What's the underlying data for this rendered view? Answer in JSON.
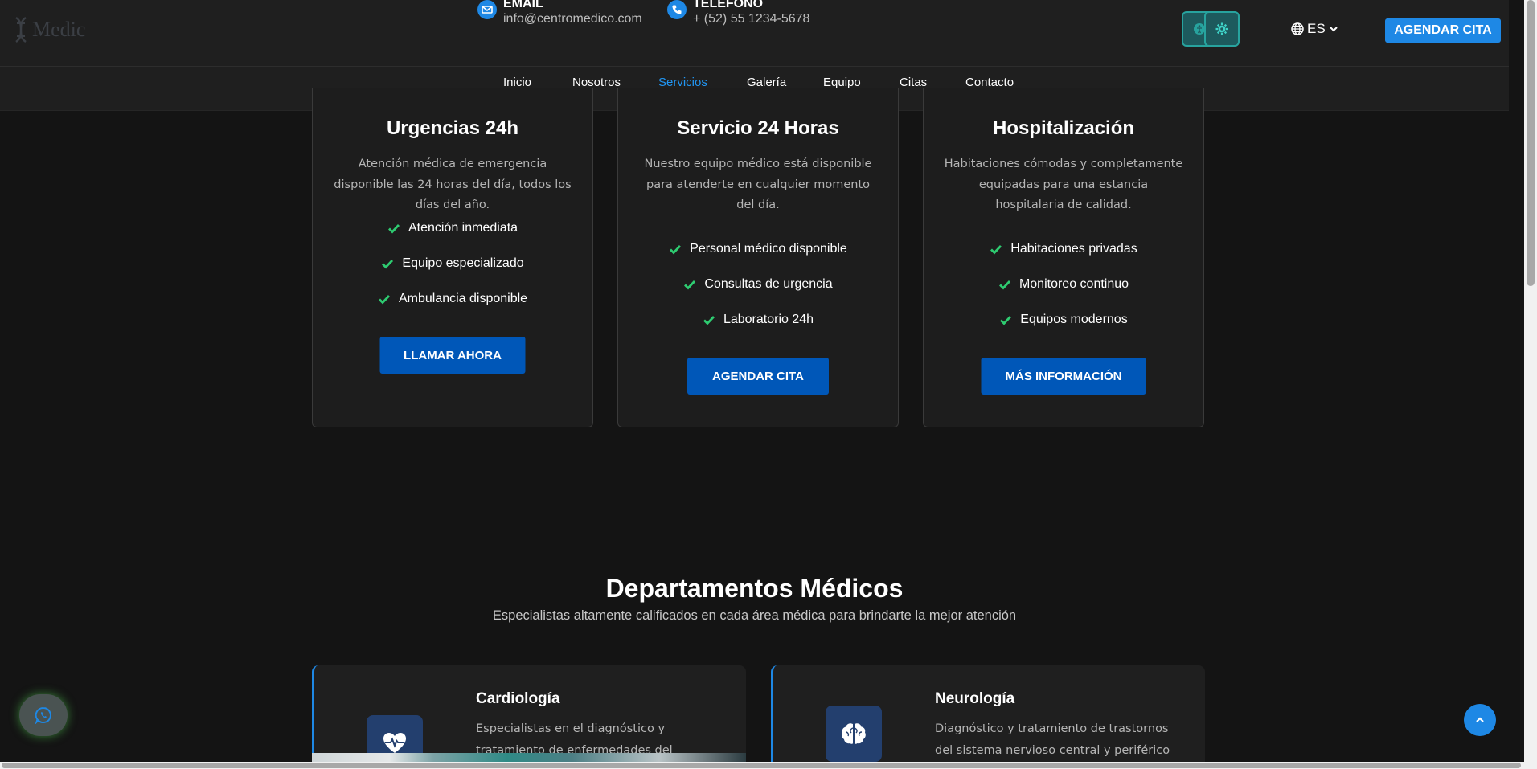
{
  "header": {
    "logo_text": "Medic",
    "contacts": [
      {
        "label": "EMAIL",
        "value": "info@centromedico.com",
        "icon": "mail-icon"
      },
      {
        "label": "TELEFONO",
        "value": "+ (52) 55 1234-5678",
        "icon": "phone-icon"
      }
    ],
    "language": "ES",
    "cta_label": "AGENDAR CITA"
  },
  "nav": {
    "items": [
      "Inicio",
      "Nosotros",
      "Servicios",
      "Galería",
      "Equipo",
      "Citas",
      "Contacto"
    ],
    "active": "Servicios"
  },
  "services": [
    {
      "title": "Urgencias 24h",
      "description": "Atención médica de emergencia disponible las 24 horas del día, todos los días del año.",
      "features": [
        "Atención inmediata",
        "Equipo especializado",
        "Ambulancia disponible"
      ],
      "button": "LLAMAR AHORA"
    },
    {
      "title": "Servicio 24 Horas",
      "description": "Nuestro equipo médico está disponible para atenderte en cualquier momento del día.",
      "features": [
        "Personal médico disponible",
        "Consultas de urgencia",
        "Laboratorio 24h"
      ],
      "button": "AGENDAR CITA"
    },
    {
      "title": "Hospitalización",
      "description": "Habitaciones cómodas y completamente equipadas para una estancia hospitalaria de calidad.",
      "features": [
        "Habitaciones privadas",
        "Monitoreo continuo",
        "Equipos modernos"
      ],
      "button": "MÁS INFORMACIÓN"
    }
  ],
  "departments": {
    "title": "Departamentos Médicos",
    "subtitle": "Especialistas altamente calificados en cada área médica para brindarte la mejor atención",
    "items": [
      {
        "name": "Cardiología",
        "description": "Especialistas en el diagnóstico y tratamiento de enfermedades del corazón y sistema",
        "icon": "heart-pulse-icon"
      },
      {
        "name": "Neurología",
        "description": "Diagnóstico y tratamiento de trastornos del sistema nervioso central y periférico",
        "icon": "brain-icon"
      }
    ]
  },
  "colors": {
    "accent": "#1e88e5",
    "button": "#0057b8",
    "check": "#2ecc71",
    "background": "#141414",
    "card": "#1d1d1d"
  }
}
